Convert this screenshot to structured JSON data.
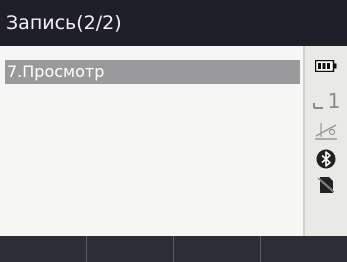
{
  "title": "Запись(2/2)",
  "menu": {
    "items": [
      {
        "label": "7.Просмотр",
        "selected": true
      }
    ]
  },
  "status": {
    "level_value": "1",
    "icons": [
      "battery-icon",
      "target-level-icon",
      "tilt-compensation-icon",
      "bluetooth-icon",
      "sd-card-icon"
    ]
  },
  "softkeys": [
    "",
    "",
    "",
    ""
  ],
  "colors": {
    "title_bg": "#1e1f27",
    "selection_bg": "#9a9a9c",
    "panel_bg": "#f6f6f4",
    "softkey_bg": "#2c2d35"
  }
}
